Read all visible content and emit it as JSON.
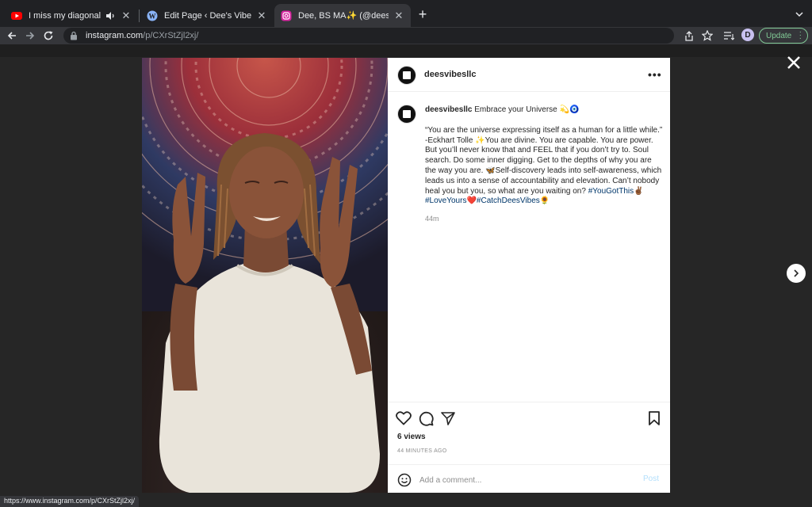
{
  "browser": {
    "tabs": [
      {
        "title": "I miss my diagonal grilled c",
        "favicon": "youtube-icon",
        "audio": true,
        "active": false
      },
      {
        "title": "Edit Page ‹ Dee's Vibes — Wor",
        "favicon": "wordpress-icon",
        "active": false
      },
      {
        "title": "Dee, BS MA✨ (@deesvibesllc",
        "favicon": "instagram-icon",
        "active": true
      }
    ],
    "new_tab_label": "+",
    "url_host": "instagram.com",
    "url_path": "/p/CXrStZjl2xj/",
    "profile_letter": "D",
    "update_label": "Update",
    "status_url": "https://www.instagram.com/p/CXrStZjl2xj/",
    "accent_update": "#81c995"
  },
  "post": {
    "username": "deesvibesllc",
    "caption_title": "Embrace your Universe 💫🧿",
    "caption_body": "“You are the universe expressing itself as a human for a little while.” -Eckhart Tolle ✨You are divine. You are capable. You are power. But you’ll never know that and FEEL that if you don’t try to. Soul search. Do some inner digging. Get to the depths of why you are the way you are. 🦋Self-discovery leads into self-awareness, which leads us into a sense of accountability and elevation. Can’t nobody heal you but you, so what are you waiting on?",
    "hashtags": [
      {
        "text": "#YouGotThis",
        "emoji": "✌🏾"
      },
      {
        "text": "#LoveYours",
        "emoji": "❤️"
      },
      {
        "text": "#CatchDeesVibes",
        "emoji": "🌻"
      }
    ],
    "caption_time": "44m",
    "views": "6 views",
    "time_ago": "44 MINUTES AGO",
    "comment_placeholder": "Add a comment...",
    "post_label": "Post",
    "link_color": "#00376b"
  }
}
